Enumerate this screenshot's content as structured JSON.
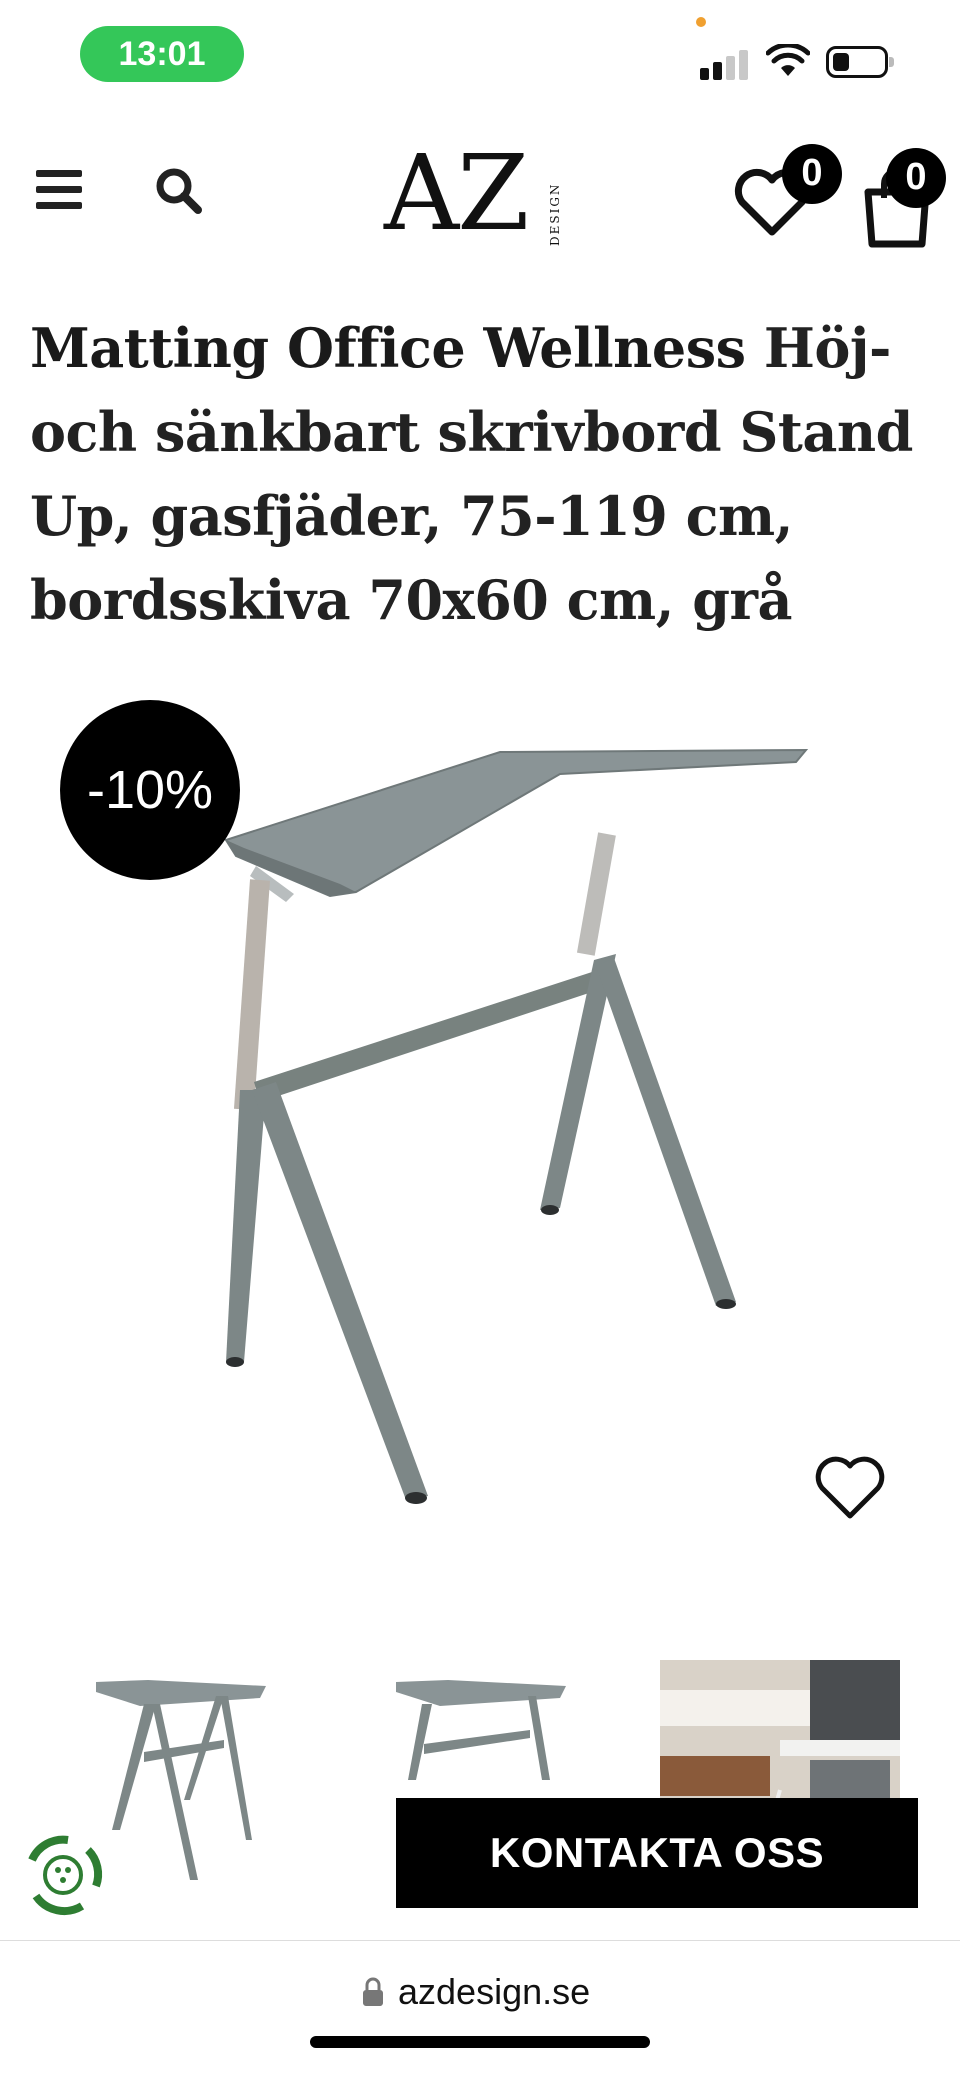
{
  "status_bar": {
    "time": "13:01"
  },
  "header": {
    "logo_main": "AZ",
    "logo_sub": "DESIGN",
    "wishlist_count": "0",
    "cart_count": "0"
  },
  "product": {
    "brand": "Matting Office Wellness",
    "title": "Höj- och sänkbart skrivbord Stand Up, gasfjäder, 75-119 cm, bordsskiva 70x60 cm, grå",
    "discount": "-10%"
  },
  "contact_button": "KONTAKTA OSS",
  "browser": {
    "url": "azdesign.se"
  },
  "colors": {
    "status_green": "#34c759",
    "badge_black": "#000000",
    "desk_gray": "#8a9496",
    "chat_green": "#2e7d32"
  },
  "icons": [
    "hamburger-icon",
    "search-icon",
    "heart-icon",
    "shopping-bag-icon",
    "lock-icon",
    "chat-widget-icon"
  ]
}
